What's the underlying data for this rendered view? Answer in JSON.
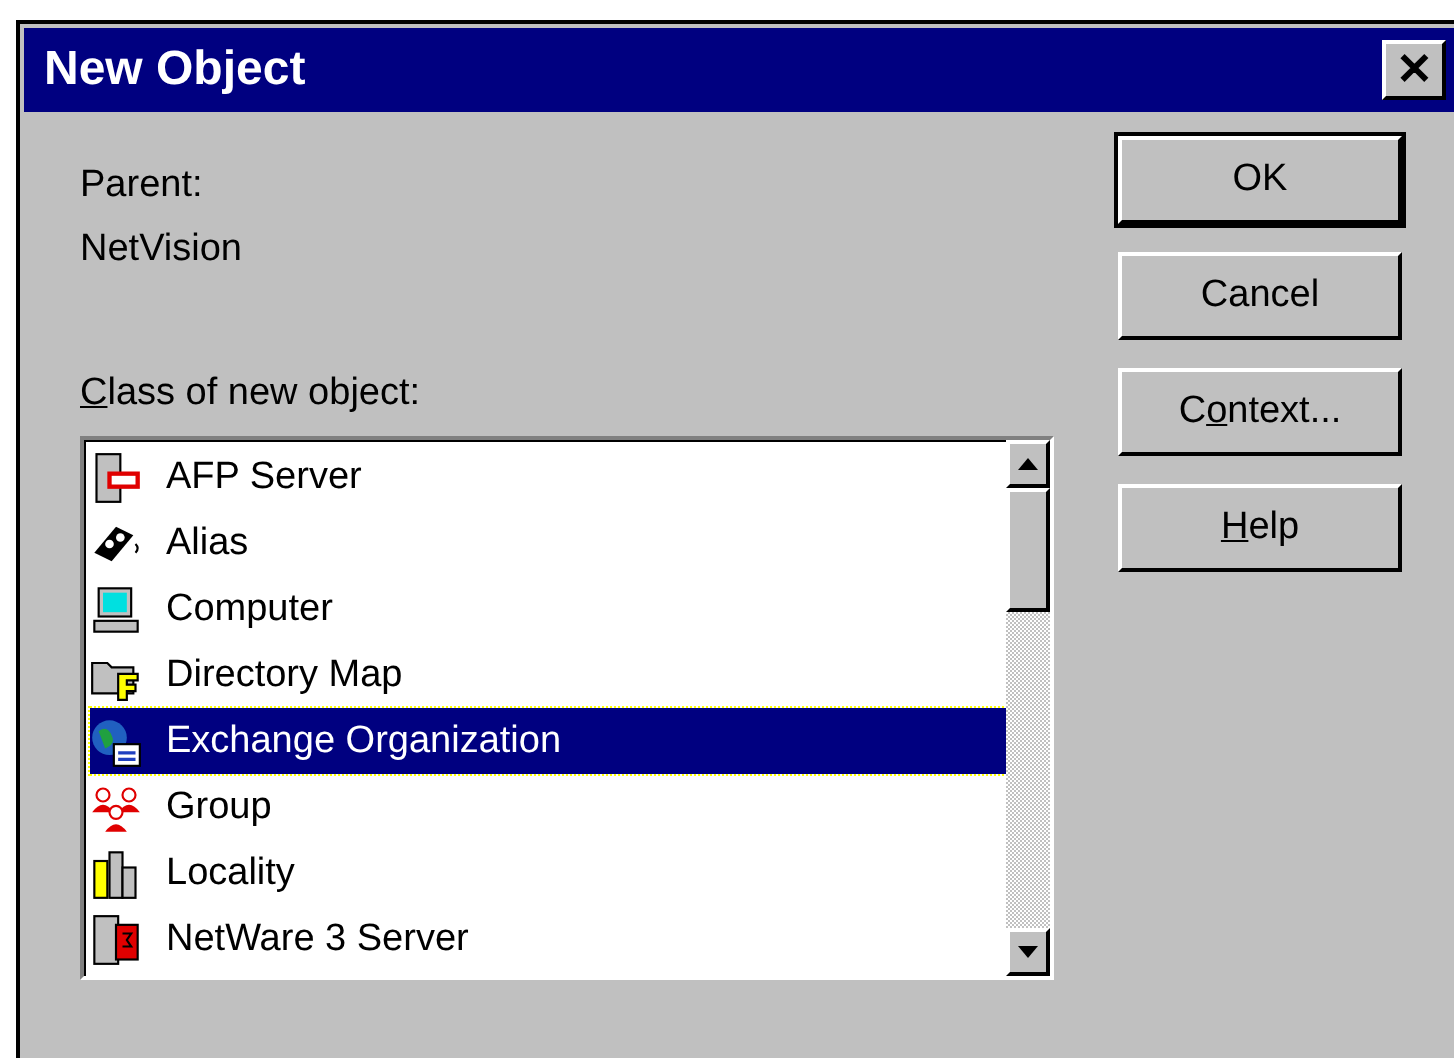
{
  "window": {
    "title": "New Object",
    "close": "✕"
  },
  "parent": {
    "label": "Parent:",
    "value": "NetVision"
  },
  "class_list": {
    "mnemonic": "C",
    "label_after": "lass of new object:",
    "items": [
      {
        "label": "AFP Server",
        "kind": "afp",
        "selected": false
      },
      {
        "label": "Alias",
        "kind": "alias",
        "selected": false
      },
      {
        "label": "Computer",
        "kind": "computer",
        "selected": false
      },
      {
        "label": "Directory Map",
        "kind": "dirmap",
        "selected": false
      },
      {
        "label": "Exchange Organization",
        "kind": "exchange",
        "selected": true
      },
      {
        "label": "Group",
        "kind": "group",
        "selected": false
      },
      {
        "label": "Locality",
        "kind": "locality",
        "selected": false
      },
      {
        "label": "NetWare 3 Server",
        "kind": "netware",
        "selected": false
      }
    ]
  },
  "buttons": [
    {
      "label": "OK",
      "default": true
    },
    {
      "label": "Cancel",
      "default": false
    },
    {
      "label_before": "C",
      "mnemonic": "o",
      "label_after": "ntext...",
      "default": false
    },
    {
      "mnemonic": "H",
      "label_after": "elp",
      "default": false
    }
  ]
}
